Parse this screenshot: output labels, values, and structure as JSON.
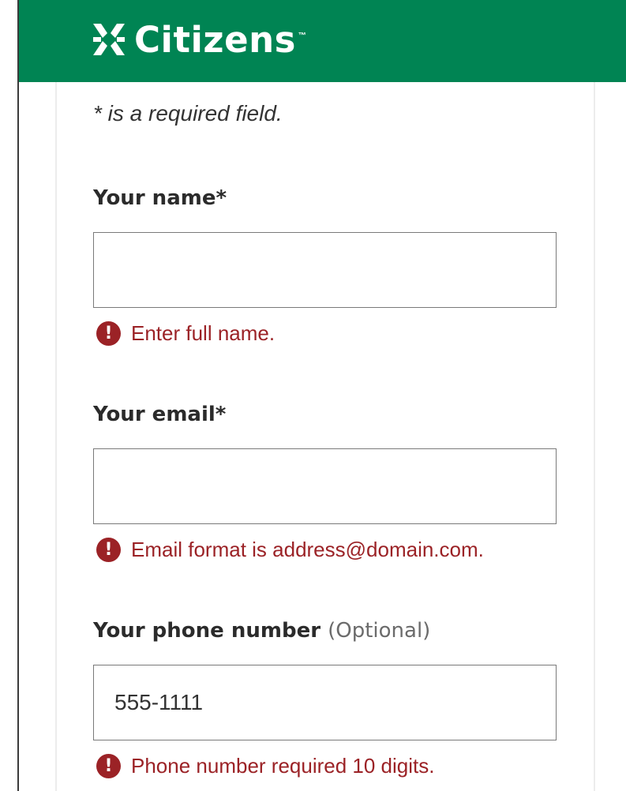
{
  "header": {
    "brand": "Citizens",
    "trademark": "™",
    "background_color": "#008453",
    "logo_icon": "citizens-logo-icon"
  },
  "form": {
    "required_note": "* is a required field.",
    "error_color": "#9b2226",
    "fields": [
      {
        "label": "Your name*",
        "optional_text": "",
        "value": "",
        "placeholder": "",
        "error": "Enter full name."
      },
      {
        "label": "Your email*",
        "optional_text": "",
        "value": "",
        "placeholder": "",
        "error": "Email format is address@domain.com."
      },
      {
        "label": "Your phone number",
        "optional_text": "(Optional)",
        "value": "555-1111",
        "placeholder": "",
        "error": "Phone number required 10 digits."
      }
    ]
  },
  "icons": {
    "error": "error-exclamation-icon",
    "error_glyph": "!"
  }
}
